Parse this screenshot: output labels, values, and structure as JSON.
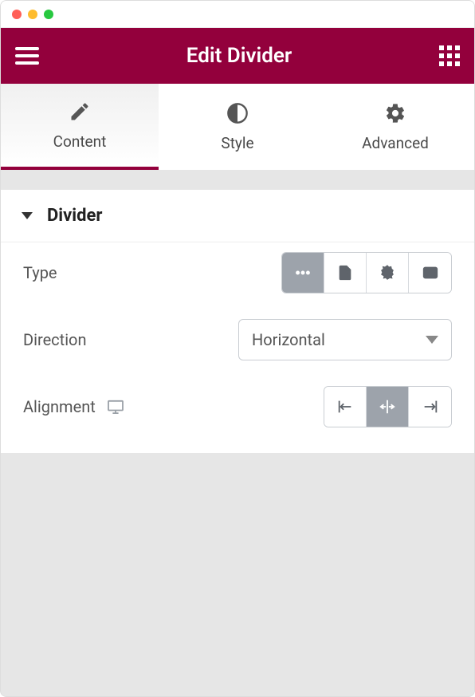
{
  "header": {
    "title": "Edit Divider"
  },
  "tabs": {
    "content": "Content",
    "style": "Style",
    "advanced": "Advanced",
    "active": "content"
  },
  "section": {
    "title": "Divider"
  },
  "controls": {
    "type": {
      "label": "Type",
      "selected_index": 0
    },
    "direction": {
      "label": "Direction",
      "value": "Horizontal"
    },
    "alignment": {
      "label": "Alignment",
      "selected_index": 1
    }
  }
}
